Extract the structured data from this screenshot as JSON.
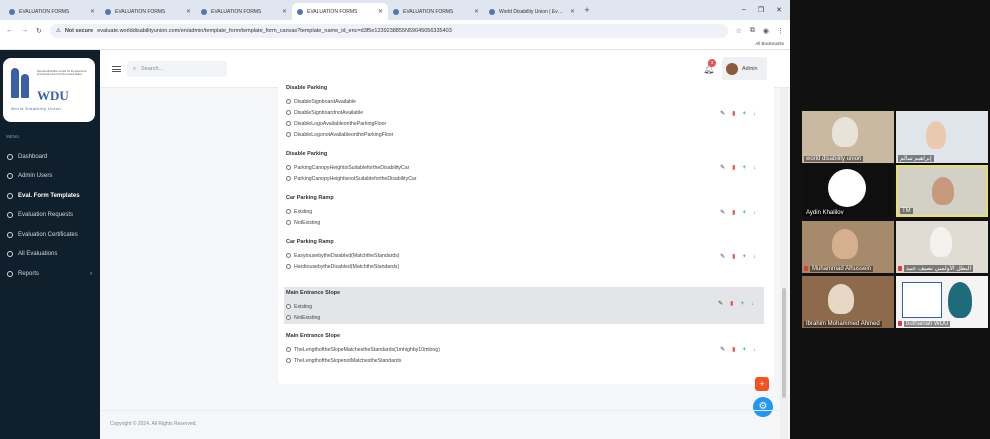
{
  "browser": {
    "tabs": [
      {
        "title": "EVALUATION FORMS",
        "active": false
      },
      {
        "title": "EVALUATION FORMS",
        "active": false
      },
      {
        "title": "EVALUATION FORMS",
        "active": false
      },
      {
        "title": "EVALUATION FORMS",
        "active": true
      },
      {
        "title": "EVALUATION FORMS",
        "active": false
      },
      {
        "title": "World Disability Union | Evalu...",
        "active": false
      }
    ],
    "not_secure": "Not secure",
    "url": "evaluate.worlddisabilityunion.com/en/admin/template_form/template_form_canvas?template_name_id_enc=d3f5e1239238855N59045056335403",
    "bookmarks_label": "All Bookmarks"
  },
  "sidebar": {
    "logo_text": "WDU",
    "logo_subtitle": "World Disability Union",
    "logo_tagline": "Special Arbitration Center for the Economic and Social Council of the United States",
    "menu_header": "MENU",
    "items": [
      {
        "label": "Dashboard",
        "icon": "dashboard-icon"
      },
      {
        "label": "Admin Users",
        "icon": "user-icon"
      },
      {
        "label": "Eval. Form Templates",
        "icon": "template-icon"
      },
      {
        "label": "Evaluation Requests",
        "icon": "request-icon"
      },
      {
        "label": "Evaluation Certificates",
        "icon": "certificate-icon"
      },
      {
        "label": "All Evaluations",
        "icon": "list-icon"
      },
      {
        "label": "Reports",
        "icon": "reports-icon"
      }
    ]
  },
  "topbar": {
    "search_placeholder": "Search...",
    "notification_count": "3",
    "user_name": "Admin"
  },
  "questions": [
    {
      "title": "Disable Parking",
      "options": [
        "DisableSignboardAvailable",
        "DisableSignboardnotAvailable",
        "DisableLogoAvailableontheParkingFloor",
        "DisableLogonotAvailableontheParkingFloor"
      ]
    },
    {
      "title": "Disable Parking",
      "options": [
        "ParkingCanopyHeightisSuitablefortheDisabilityCar",
        "ParkingCanopyHeightisnotSuitablefortheDisabilityCar"
      ]
    },
    {
      "title": "Car Parking Ramp",
      "options": [
        "Existing",
        "NotExisting"
      ]
    },
    {
      "title": "Car Parking Ramp",
      "options": [
        "EasytousebytheDisabled(MatchtheStandards)",
        "HardtousebytheDisabled(MatchtheStandards)"
      ]
    },
    {
      "title": "Main Entrance Slope",
      "options": [
        "Existing",
        "NotExisting"
      ],
      "highlighted": true
    },
    {
      "title": "Main Entrance Slope",
      "options": [
        "TheLengthoftheSlopeMatchestheStandards(1mhighby10mlong)",
        "TheLengthoftheSlopenotMatchestheStandards"
      ]
    }
  ],
  "actions": {
    "edit": "✎",
    "delete": "🗑",
    "add": "+",
    "down": "↓"
  },
  "footer": {
    "copyright": "Copyright © 2024. All Rights Reserved."
  },
  "fab": {
    "add": "+",
    "settings": "⚙"
  },
  "video_tiles": [
    {
      "name": "world disability union",
      "muted": false
    },
    {
      "name": "إبراهيم سالم",
      "muted": false
    },
    {
      "name": "Aydin Khalilov",
      "muted": false
    },
    {
      "name": "TM",
      "muted": false
    },
    {
      "name": "Muhammad Alhussein",
      "muted": true
    },
    {
      "name": "البطل الأولمبي نصيف عبيد",
      "muted": true
    },
    {
      "name": "Ibrahim Mohammed Ahmed",
      "muted": false
    },
    {
      "name": "buthainah WDU",
      "muted": true
    }
  ],
  "colors": {
    "sidebar_bg": "#0f1f2c",
    "accent_blue": "#2196f3",
    "danger": "#e55353",
    "success": "#2eb85c",
    "fab_orange": "#f4511e"
  }
}
